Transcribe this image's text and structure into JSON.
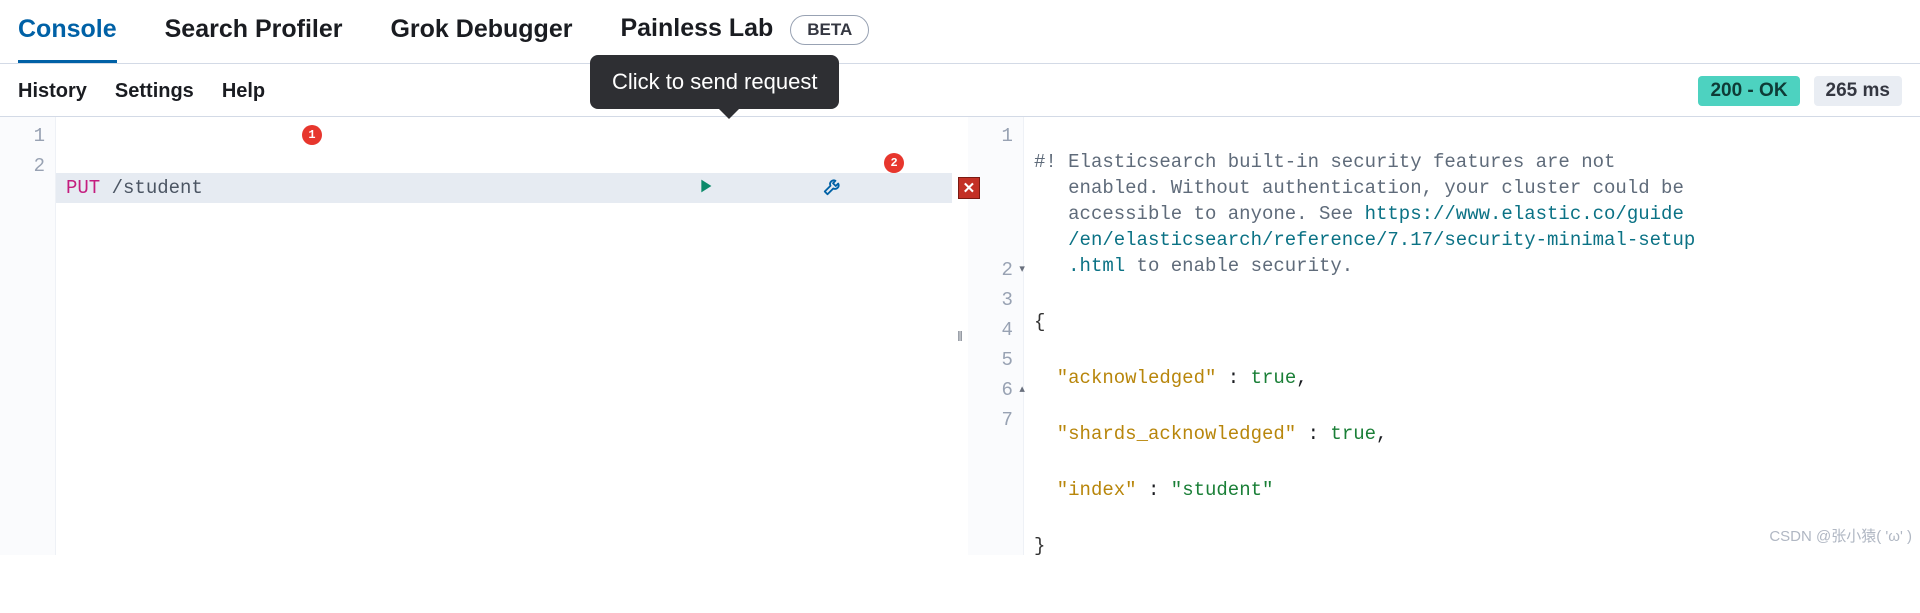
{
  "tabs": {
    "console": "Console",
    "profiler": "Search Profiler",
    "grok": "Grok Debugger",
    "painless": "Painless Lab",
    "beta": "BETA"
  },
  "subnav": {
    "history": "History",
    "settings": "Settings",
    "help": "Help"
  },
  "status": {
    "code_label": "200 - OK",
    "time_label": "265 ms"
  },
  "tooltip": "Click to send request",
  "request": {
    "lines": [
      "1",
      "2"
    ],
    "method": "PUT",
    "path": " /student"
  },
  "annotations": {
    "a1": "1",
    "a2": "2"
  },
  "response": {
    "lines": [
      "1",
      "2",
      "3",
      "4",
      "5",
      "6",
      "7"
    ],
    "warning_pre": "#! Elasticsearch built-in security features are not\n   enabled. Without authentication, your cluster could be\n   accessible to anyone. See ",
    "warning_url": "https://www.elastic.co/guide\n   /en/elasticsearch/reference/7.17/security-minimal-setup\n   .html",
    "warning_post": " to enable security.",
    "json": {
      "open": "{",
      "k1": "\"acknowledged\"",
      "c1": " : ",
      "v1": "true",
      "comma": ",",
      "k2": "\"shards_acknowledged\"",
      "v2": "true",
      "k3": "\"index\"",
      "v3": "\"student\"",
      "close": "}"
    }
  },
  "watermark": "CSDN @张小猿( 'ω' )"
}
